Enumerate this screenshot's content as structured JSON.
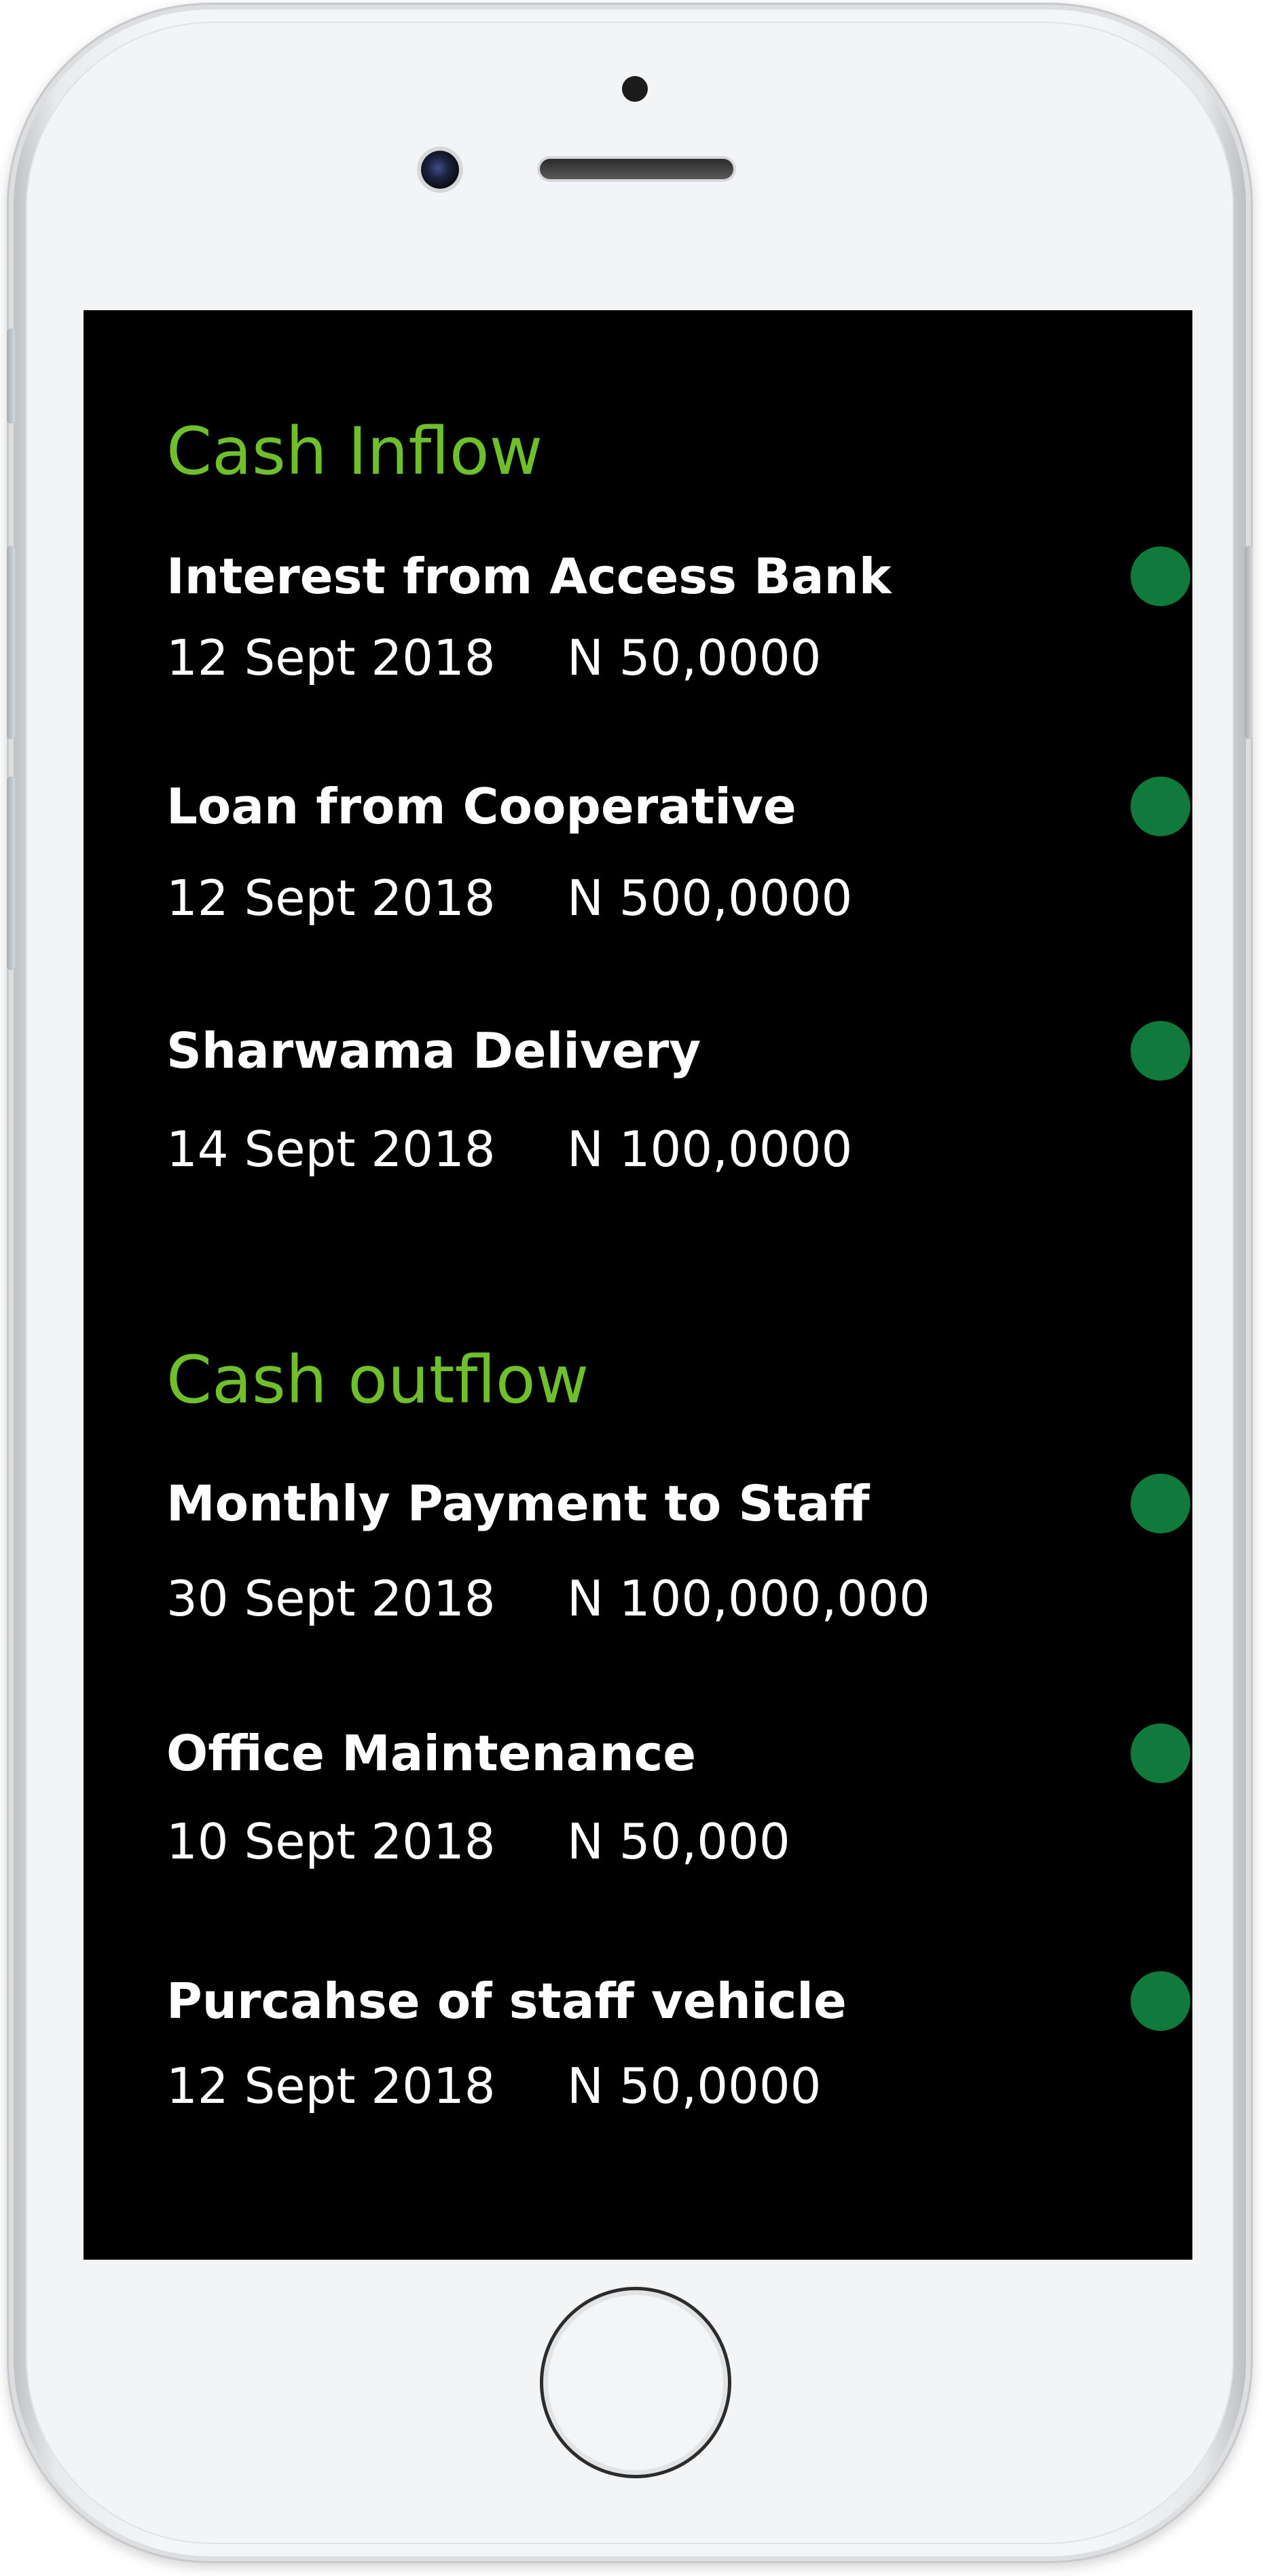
{
  "colors": {
    "screen_background": "#000000",
    "section_title": "#6fbe2c",
    "entry_text": "#ffffff",
    "status_dot": "#0f7a3c"
  },
  "cash_inflow": {
    "title": "Cash Inflow",
    "entries": [
      {
        "title": "Interest from Access Bank",
        "date": "12 Sept 2018",
        "amount": "N 50,0000",
        "status_icon": "status-dot-icon"
      },
      {
        "title": "Loan from Cooperative",
        "date": "12 Sept 2018",
        "amount": "N 500,0000",
        "status_icon": "status-dot-icon"
      },
      {
        "title": "Sharwama Delivery",
        "date": "14 Sept 2018",
        "amount": "N 100,0000",
        "status_icon": "status-dot-icon"
      }
    ]
  },
  "cash_outflow": {
    "title": "Cash outflow",
    "entries": [
      {
        "title": "Monthly Payment to Staff",
        "date": "30 Sept 2018",
        "amount": "N 100,000,000",
        "status_icon": "status-dot-icon"
      },
      {
        "title": "Office Maintenance",
        "date": "10 Sept 2018",
        "amount": "N 50,000",
        "status_icon": "status-dot-icon"
      },
      {
        "title": "Purcahse of staff vehicle",
        "date": "12 Sept 2018",
        "amount": "N 50,0000",
        "status_icon": "status-dot-icon"
      }
    ]
  }
}
